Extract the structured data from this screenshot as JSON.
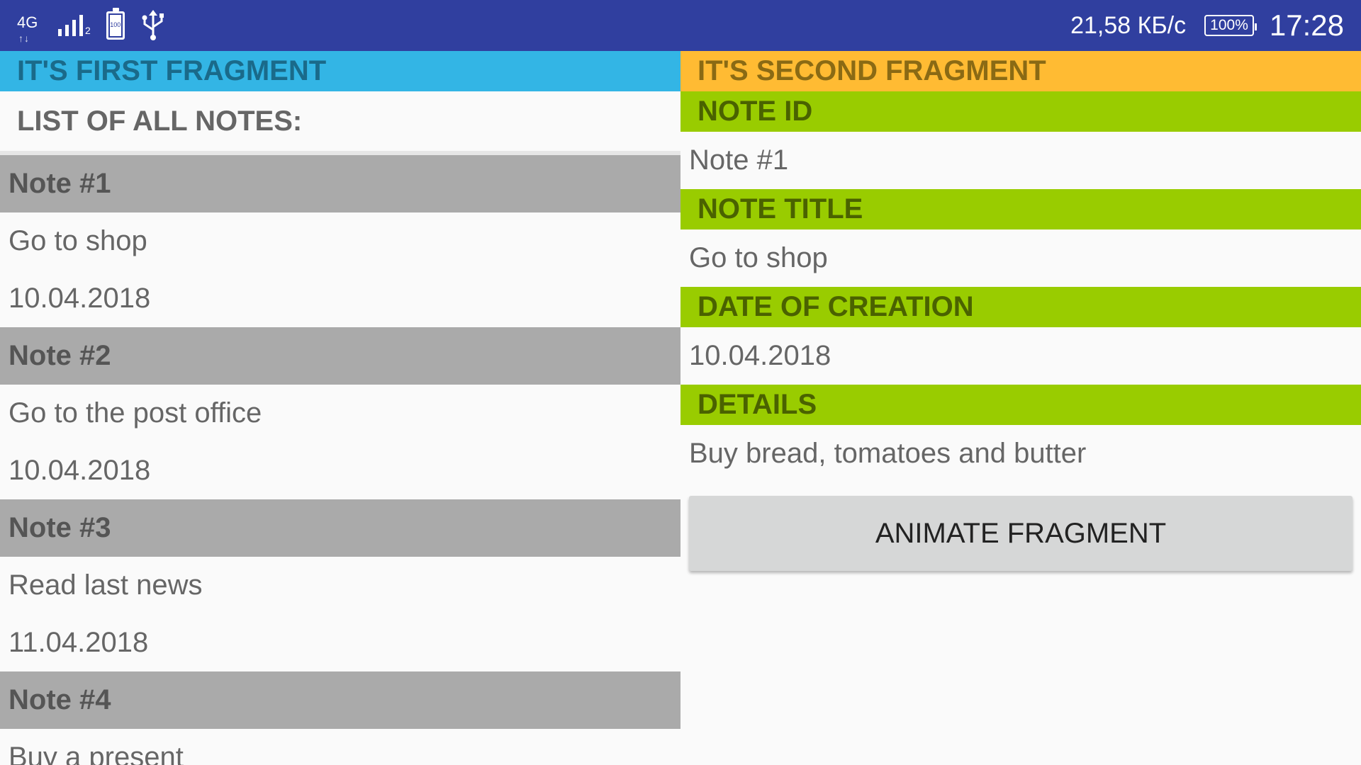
{
  "status_bar": {
    "network_type": "4G",
    "sim_slot": "2",
    "battery_icon_level": "100",
    "net_speed": "21,58 КБ/с",
    "battery_percent": "100%",
    "time": "17:28",
    "icons": [
      "network-type-icon",
      "signal-icon",
      "battery-icon",
      "usb-icon"
    ],
    "background_color": "#303f9f"
  },
  "fragment1": {
    "header": "IT'S FIRST FRAGMENT",
    "header_color": "#33b5e5",
    "list_title": "LIST OF ALL NOTES:",
    "notes": [
      {
        "id": "Note #1",
        "title": "Go to shop",
        "date": "10.04.2018"
      },
      {
        "id": "Note #2",
        "title": "Go to the post office",
        "date": "10.04.2018"
      },
      {
        "id": "Note #3",
        "title": "Read last news",
        "date": "11.04.2018"
      },
      {
        "id": "Note #4",
        "title": "Buy a present",
        "date": ""
      }
    ]
  },
  "fragment2": {
    "header": "IT'S SECOND FRAGMENT",
    "header_color": "#ffbb33",
    "field_color": "#99cc00",
    "fields": [
      {
        "label": "NOTE ID",
        "value": "Note #1"
      },
      {
        "label": "NOTE TITLE",
        "value": "Go to shop"
      },
      {
        "label": "DATE OF CREATION",
        "value": "10.04.2018"
      },
      {
        "label": "DETAILS",
        "value": "Buy bread, tomatoes and butter"
      }
    ],
    "button_label": "ANIMATE FRAGMENT"
  }
}
